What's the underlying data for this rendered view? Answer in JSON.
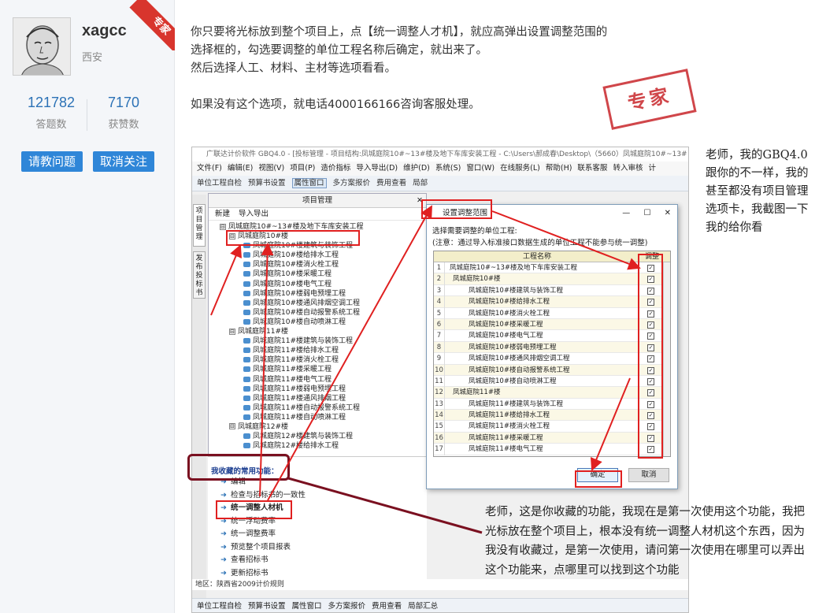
{
  "profile": {
    "username": "xagcc",
    "location": "西安",
    "badge": "专家",
    "answers_count": "121782",
    "answers_label": "答题数",
    "likes_count": "7170",
    "likes_label": "获赞数",
    "ask_button": "请教问题",
    "unfollow_button": "取消关注"
  },
  "answer": {
    "line1": "你只要将光标放到整个项目上，点【统一调整人才机】，就应高弹出设置调整范围的",
    "line2": "选择框的，勾选要调整的单位工程名称后确定，就出来了。",
    "line3": "然后选择人工、材料、主材等选项看看。",
    "line4": "如果没有这个选项，就电话4000166166咨询客服处理。",
    "stamp": "专家"
  },
  "user_note": "老师，我的GBQ4.0跟你的不一样，我的甚至都没有项目管理选项卡，我截图一下我的给你看",
  "question_note": "老师，这是你收藏的功能，我现在是第一次使用这个功能，我把光标放在整个项目上，根本没有统一调整人材机这个东西，因为我没有收藏过，是第一次使用，请问第一次使用在哪里可以弄出这个功能来，点哪里可以找到这个功能",
  "screenshot": {
    "title": "广联达计价软件 GBQ4.0 - [投标管理 - 项目结构:凤城庭院10#~13#楼及地下车库安装工程 - C:\\Users\\郝成春\\Desktop\\（5660）凤城庭院10#~13#",
    "menu": [
      "文件(F)",
      "编辑(E)",
      "视图(V)",
      "项目(P)",
      "造价指标",
      "导入导出(D)",
      "维护(D)",
      "系统(S)",
      "窗口(W)",
      "在线服务(L)",
      "帮助(H)",
      "联系客服",
      "转入审核",
      "计"
    ],
    "toolbar": [
      "单位工程自检",
      "预算书设置",
      "属性窗口",
      "多方案报价",
      "费用查看",
      "局部"
    ],
    "toolbar_bottom": [
      "单位工程自检",
      "预算书设置",
      "属性窗口",
      "多方案报价",
      "费用查看",
      "局部汇总"
    ],
    "side_tab1": "项目管理",
    "side_tab2": "发布投标书",
    "panel_title": "项目管理",
    "panel_close": "✕",
    "panel_new": "新建",
    "panel_import": "导入导出",
    "tree": [
      {
        "level": 0,
        "toggle": "⊟",
        "text": "凤城庭院10#~13#楼及地下车库安装工程"
      },
      {
        "level": 1,
        "toggle": "⊟",
        "text": "凤城庭院10#楼"
      },
      {
        "level": 2,
        "text": "凤城庭院10#楼建筑与装饰工程"
      },
      {
        "level": 2,
        "text": "凤城庭院10#楼给排水工程"
      },
      {
        "level": 2,
        "text": "凤城庭院10#楼消火栓工程"
      },
      {
        "level": 2,
        "text": "凤城庭院10#楼采暖工程"
      },
      {
        "level": 2,
        "text": "凤城庭院10#楼电气工程"
      },
      {
        "level": 2,
        "text": "凤城庭院10#楼弱电预埋工程"
      },
      {
        "level": 2,
        "text": "凤城庭院10#楼通风排烟空调工程"
      },
      {
        "level": 2,
        "text": "凤城庭院10#楼自动报警系统工程"
      },
      {
        "level": 2,
        "text": "凤城庭院10#楼自动喷淋工程"
      },
      {
        "level": 1,
        "toggle": "⊟",
        "text": "凤城庭院11#楼"
      },
      {
        "level": 2,
        "text": "凤城庭院11#楼建筑与装饰工程"
      },
      {
        "level": 2,
        "text": "凤城庭院11#楼给排水工程"
      },
      {
        "level": 2,
        "text": "凤城庭院11#楼消火栓工程"
      },
      {
        "level": 2,
        "text": "凤城庭院11#楼采暖工程"
      },
      {
        "level": 2,
        "text": "凤城庭院11#楼电气工程"
      },
      {
        "level": 2,
        "text": "凤城庭院11#楼弱电预埋工程"
      },
      {
        "level": 2,
        "text": "凤城庭院11#楼通风排烟工程"
      },
      {
        "level": 2,
        "text": "凤城庭院11#楼自动报警系统工程"
      },
      {
        "level": 2,
        "text": "凤城庭院11#楼自动喷淋工程"
      },
      {
        "level": 1,
        "toggle": "⊟",
        "text": "凤城庭院12#楼"
      },
      {
        "level": 2,
        "text": "凤城庭院12#楼建筑与装饰工程"
      },
      {
        "level": 2,
        "text": "凤城庭院12#楼给排水工程"
      }
    ],
    "fav_title": "我收藏的常用功能：",
    "favorites": [
      {
        "text": "编辑",
        "bold": false
      },
      {
        "text": "检查与招标书的一致性",
        "bold": false
      },
      {
        "text": "统一调整人材机",
        "bold": true
      },
      {
        "text": "统一浮动费率",
        "bold": false
      },
      {
        "text": "统一调整费率",
        "bold": false
      },
      {
        "text": "预览整个项目报表",
        "bold": false
      },
      {
        "text": "查看招标书",
        "bold": false
      },
      {
        "text": "更新招标书",
        "bold": false
      }
    ],
    "area_label": "地区：陕西省2009计价规则",
    "dialog": {
      "title": "设置调整范围",
      "min": "—",
      "max": "☐",
      "close": "✕",
      "hint1": "选择需要调整的单位工程:",
      "hint2": "(注意：通过导入标准接口数据生成的单位工程不能参与统一调整)",
      "col_name": "工程名称",
      "col_adjust": "调整",
      "rows": [
        {
          "no": "1",
          "level": 0,
          "text": "凤城庭院10#~13#楼及地下车库安装工程"
        },
        {
          "no": "2",
          "level": 1,
          "text": "凤城庭院10#楼"
        },
        {
          "no": "3",
          "level": 2,
          "text": "凤城庭院10#楼建筑与装饰工程"
        },
        {
          "no": "4",
          "level": 2,
          "text": "凤城庭院10#楼给排水工程"
        },
        {
          "no": "5",
          "level": 2,
          "text": "凤城庭院10#楼消火栓工程"
        },
        {
          "no": "6",
          "level": 2,
          "text": "凤城庭院10#楼采暖工程"
        },
        {
          "no": "7",
          "level": 2,
          "text": "凤城庭院10#楼电气工程"
        },
        {
          "no": "8",
          "level": 2,
          "text": "凤城庭院10#楼弱电预埋工程"
        },
        {
          "no": "9",
          "level": 2,
          "text": "凤城庭院10#楼通风排烟空调工程"
        },
        {
          "no": "10",
          "level": 2,
          "text": "凤城庭院10#楼自动报警系统工程"
        },
        {
          "no": "11",
          "level": 2,
          "text": "凤城庭院10#楼自动喷淋工程"
        },
        {
          "no": "12",
          "level": 1,
          "text": "凤城庭院11#楼"
        },
        {
          "no": "13",
          "level": 2,
          "text": "凤城庭院11#楼建筑与装饰工程"
        },
        {
          "no": "14",
          "level": 2,
          "text": "凤城庭院11#楼给排水工程"
        },
        {
          "no": "15",
          "level": 2,
          "text": "凤城庭院11#楼消火栓工程"
        },
        {
          "no": "16",
          "level": 2,
          "text": "凤城庭院11#楼采暖工程"
        },
        {
          "no": "17",
          "level": 2,
          "text": "凤城庭院11#楼电气工程"
        }
      ],
      "ok": "确定",
      "cancel": "取消"
    }
  },
  "colors": {
    "accent_blue": "#2f86d8",
    "stat_blue": "#2c72b6",
    "annotation_red": "#e02020",
    "annotation_maroon": "#7a1020"
  }
}
